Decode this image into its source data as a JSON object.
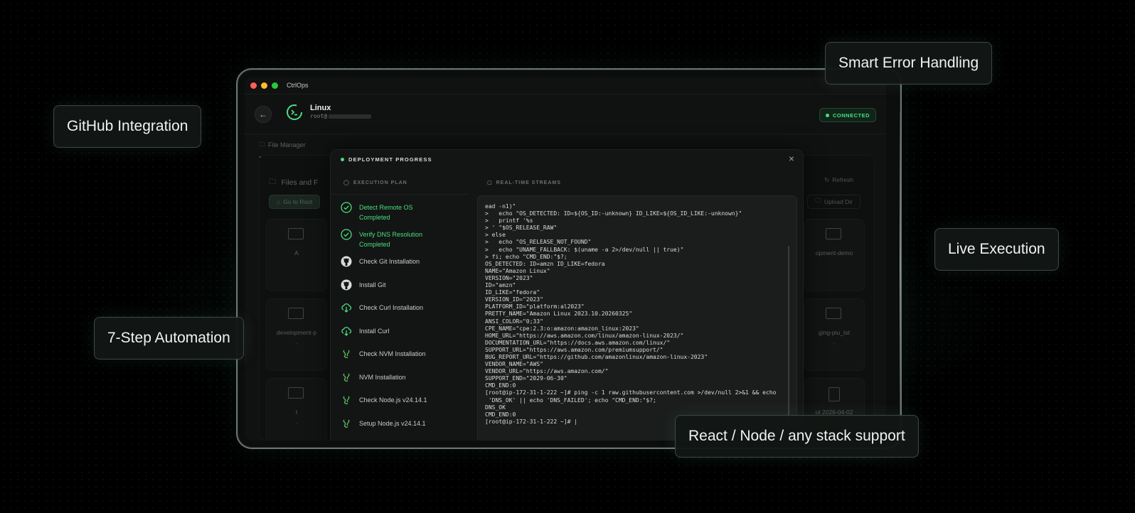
{
  "app": {
    "window_title": "CtrlOps",
    "host_title": "Linux",
    "host_user": "root@",
    "status": "CONNECTED",
    "accent": "#4ade80"
  },
  "tabs": [
    "File Manager"
  ],
  "file_manager": {
    "title": "Files and F",
    "go_root": "Go to Root",
    "refresh": "Refresh",
    "upload": "Upload Dir",
    "cards": [
      {
        "label": "A",
        "sub": ""
      },
      {
        "label": "opment-demo",
        "sub": ""
      },
      {
        "label": "development-p",
        "sub": "-"
      },
      {
        "label": "ging-piu_tst",
        "sub": "-"
      },
      {
        "label": "t",
        "sub": "-"
      },
      {
        "label": "ot 2026-04-02",
        "sub": ""
      }
    ]
  },
  "modal": {
    "title": "DEPLOYMENT PROGRESS",
    "close_icon": "close-icon",
    "plan_title": "EXECUTION PLAN",
    "streams_title": "REAL-TIME STREAMS",
    "steps": [
      {
        "label": "Detect Remote OS",
        "status": "Completed",
        "icon": "check-circle-icon"
      },
      {
        "label": "Verify DNS Resolution",
        "status": "Completed",
        "icon": "check-circle-icon"
      },
      {
        "label": "Check Git Installation",
        "status": "",
        "icon": "github-icon"
      },
      {
        "label": "Install Git",
        "status": "",
        "icon": "github-icon"
      },
      {
        "label": "Check Curl Installation",
        "status": "",
        "icon": "cloud-download-icon"
      },
      {
        "label": "Install Curl",
        "status": "",
        "icon": "cloud-download-icon"
      },
      {
        "label": "Check NVM Installation",
        "status": "",
        "icon": "nodejs-icon"
      },
      {
        "label": "NVM Installation",
        "status": "",
        "icon": "nodejs-icon"
      },
      {
        "label": "Check Node.js v24.14.1",
        "status": "",
        "icon": "nodejs-icon"
      },
      {
        "label": "Setup Node.js v24.14.1",
        "status": "",
        "icon": "nodejs-icon"
      }
    ],
    "terminal_text": "ead -n1)\"\n>   echo \"OS_DETECTED: ID=${OS_ID:-unknown} ID_LIKE=${OS_ID_LIKE:-unknown}\"\n>   printf '%s\n> ' \"$OS_RELEASE_RAW\"\n> else\n>   echo \"OS_RELEASE_NOT_FOUND\"\n>   echo \"UNAME_FALLBACK: $(uname -a 2>/dev/null || true)\"\n> fi; echo \"CMD_END:\"$?;\nOS_DETECTED: ID=amzn ID_LIKE=fedora\nNAME=\"Amazon Linux\"\nVERSION=\"2023\"\nID=\"amzn\"\nID_LIKE=\"fedora\"\nVERSION_ID=\"2023\"\nPLATFORM_ID=\"platform:al2023\"\nPRETTY_NAME=\"Amazon Linux 2023.10.20260325\"\nANSI_COLOR=\"0;33\"\nCPE_NAME=\"cpe:2.3:o:amazon:amazon_linux:2023\"\nHOME_URL=\"https://aws.amazon.com/linux/amazon-linux-2023/\"\nDOCUMENTATION_URL=\"https://docs.aws.amazon.com/linux/\"\nSUPPORT_URL=\"https://aws.amazon.com/premiumsupport/\"\nBUG_REPORT_URL=\"https://github.com/amazonlinux/amazon-linux-2023\"\nVENDOR_NAME=\"AWS\"\nVENDOR_URL=\"https://aws.amazon.com/\"\nSUPPORT_END=\"2029-06-30\"\nCMD_END:0\n[root@ip-172-31-1-222 ~]# ping -c 1 raw.githubusercontent.com >/dev/null 2>&1 && echo\n 'DNS_OK' || echo 'DNS_FAILED'; echo \"CMD_END:\"$?;\nDNS_OK\nCMD_END:0\n[root@ip-172-31-1-222 ~]# |"
  },
  "callouts": {
    "smart_error": "Smart Error Handling",
    "github": "GitHub Integration",
    "live": "Live Execution",
    "automation": "7-Step Automation",
    "stack": "React / Node / any stack support"
  }
}
